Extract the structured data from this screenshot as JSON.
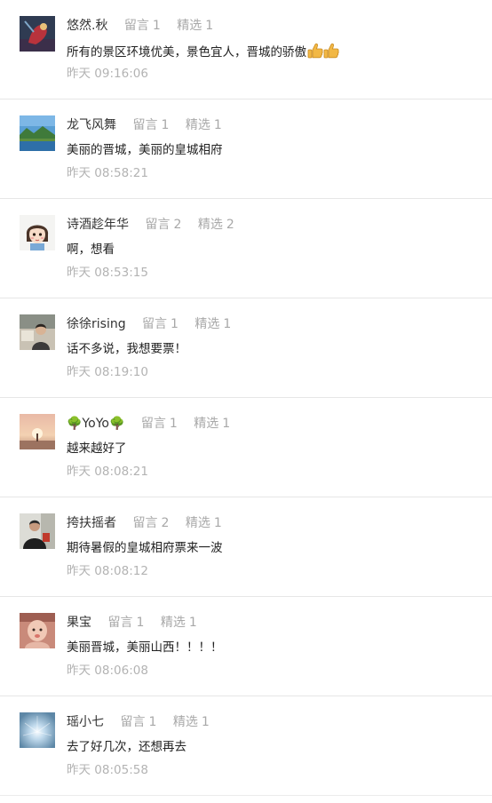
{
  "comments": [
    {
      "nickname": "悠然.秋",
      "reply_label": "留言",
      "reply_count": "1",
      "pick_label": "精选",
      "pick_count": "1",
      "content": "所有的景区环境优美，景色宜人，晋城的骄傲",
      "time": "昨天 09:16:06",
      "avatar_icon": "painting-avatar",
      "extra_icon": "thumbs-up-icon"
    },
    {
      "nickname": "龙飞风舞",
      "reply_label": "留言",
      "reply_count": "1",
      "pick_label": "精选",
      "pick_count": "1",
      "content": "美丽的晋城，美丽的皇城相府",
      "time": "昨天 08:58:21",
      "avatar_icon": "landscape-avatar"
    },
    {
      "nickname": "诗酒趁年华",
      "reply_label": "留言",
      "reply_count": "2",
      "pick_label": "精选",
      "pick_count": "2",
      "content": "啊，想看",
      "time": "昨天 08:53:15",
      "avatar_icon": "cartoon-girl-avatar"
    },
    {
      "nickname": "徐徐rising",
      "reply_label": "留言",
      "reply_count": "1",
      "pick_label": "精选",
      "pick_count": "1",
      "content": "话不多说，我想要票！",
      "time": "昨天 08:19:10",
      "avatar_icon": "photo-avatar"
    },
    {
      "nickname": "🌳YoYo🌳",
      "reply_label": "留言",
      "reply_count": "1",
      "pick_label": "精选",
      "pick_count": "1",
      "content": "越来越好了",
      "time": "昨天 08:08:21",
      "avatar_icon": "sunset-avatar"
    },
    {
      "nickname": "挎扶摇者",
      "reply_label": "留言",
      "reply_count": "2",
      "pick_label": "精选",
      "pick_count": "1",
      "content": "期待暑假的皇城相府票来一波",
      "time": "昨天 08:08:12",
      "avatar_icon": "person-avatar"
    },
    {
      "nickname": "果宝",
      "reply_label": "留言",
      "reply_count": "1",
      "pick_label": "精选",
      "pick_count": "1",
      "content": "美丽晋城，美丽山西！！！！",
      "time": "昨天 08:06:08",
      "avatar_icon": "baby-avatar"
    },
    {
      "nickname": "瑶小七",
      "reply_label": "留言",
      "reply_count": "1",
      "pick_label": "精选",
      "pick_count": "1",
      "content": "去了好几次，还想再去",
      "time": "昨天 08:05:58",
      "avatar_icon": "sky-light-avatar"
    }
  ]
}
